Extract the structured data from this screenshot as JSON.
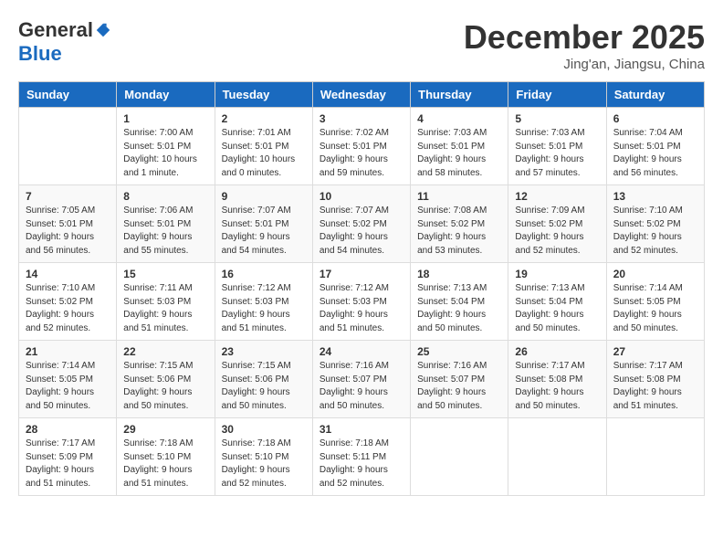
{
  "logo": {
    "general": "General",
    "blue": "Blue"
  },
  "header": {
    "month": "December 2025",
    "location": "Jing'an, Jiangsu, China"
  },
  "weekdays": [
    "Sunday",
    "Monday",
    "Tuesday",
    "Wednesday",
    "Thursday",
    "Friday",
    "Saturday"
  ],
  "weeks": [
    [
      {
        "day": "",
        "info": ""
      },
      {
        "day": "1",
        "info": "Sunrise: 7:00 AM\nSunset: 5:01 PM\nDaylight: 10 hours\nand 1 minute."
      },
      {
        "day": "2",
        "info": "Sunrise: 7:01 AM\nSunset: 5:01 PM\nDaylight: 10 hours\nand 0 minutes."
      },
      {
        "day": "3",
        "info": "Sunrise: 7:02 AM\nSunset: 5:01 PM\nDaylight: 9 hours\nand 59 minutes."
      },
      {
        "day": "4",
        "info": "Sunrise: 7:03 AM\nSunset: 5:01 PM\nDaylight: 9 hours\nand 58 minutes."
      },
      {
        "day": "5",
        "info": "Sunrise: 7:03 AM\nSunset: 5:01 PM\nDaylight: 9 hours\nand 57 minutes."
      },
      {
        "day": "6",
        "info": "Sunrise: 7:04 AM\nSunset: 5:01 PM\nDaylight: 9 hours\nand 56 minutes."
      }
    ],
    [
      {
        "day": "7",
        "info": "Sunrise: 7:05 AM\nSunset: 5:01 PM\nDaylight: 9 hours\nand 56 minutes."
      },
      {
        "day": "8",
        "info": "Sunrise: 7:06 AM\nSunset: 5:01 PM\nDaylight: 9 hours\nand 55 minutes."
      },
      {
        "day": "9",
        "info": "Sunrise: 7:07 AM\nSunset: 5:01 PM\nDaylight: 9 hours\nand 54 minutes."
      },
      {
        "day": "10",
        "info": "Sunrise: 7:07 AM\nSunset: 5:02 PM\nDaylight: 9 hours\nand 54 minutes."
      },
      {
        "day": "11",
        "info": "Sunrise: 7:08 AM\nSunset: 5:02 PM\nDaylight: 9 hours\nand 53 minutes."
      },
      {
        "day": "12",
        "info": "Sunrise: 7:09 AM\nSunset: 5:02 PM\nDaylight: 9 hours\nand 52 minutes."
      },
      {
        "day": "13",
        "info": "Sunrise: 7:10 AM\nSunset: 5:02 PM\nDaylight: 9 hours\nand 52 minutes."
      }
    ],
    [
      {
        "day": "14",
        "info": "Sunrise: 7:10 AM\nSunset: 5:02 PM\nDaylight: 9 hours\nand 52 minutes."
      },
      {
        "day": "15",
        "info": "Sunrise: 7:11 AM\nSunset: 5:03 PM\nDaylight: 9 hours\nand 51 minutes."
      },
      {
        "day": "16",
        "info": "Sunrise: 7:12 AM\nSunset: 5:03 PM\nDaylight: 9 hours\nand 51 minutes."
      },
      {
        "day": "17",
        "info": "Sunrise: 7:12 AM\nSunset: 5:03 PM\nDaylight: 9 hours\nand 51 minutes."
      },
      {
        "day": "18",
        "info": "Sunrise: 7:13 AM\nSunset: 5:04 PM\nDaylight: 9 hours\nand 50 minutes."
      },
      {
        "day": "19",
        "info": "Sunrise: 7:13 AM\nSunset: 5:04 PM\nDaylight: 9 hours\nand 50 minutes."
      },
      {
        "day": "20",
        "info": "Sunrise: 7:14 AM\nSunset: 5:05 PM\nDaylight: 9 hours\nand 50 minutes."
      }
    ],
    [
      {
        "day": "21",
        "info": "Sunrise: 7:14 AM\nSunset: 5:05 PM\nDaylight: 9 hours\nand 50 minutes."
      },
      {
        "day": "22",
        "info": "Sunrise: 7:15 AM\nSunset: 5:06 PM\nDaylight: 9 hours\nand 50 minutes."
      },
      {
        "day": "23",
        "info": "Sunrise: 7:15 AM\nSunset: 5:06 PM\nDaylight: 9 hours\nand 50 minutes."
      },
      {
        "day": "24",
        "info": "Sunrise: 7:16 AM\nSunset: 5:07 PM\nDaylight: 9 hours\nand 50 minutes."
      },
      {
        "day": "25",
        "info": "Sunrise: 7:16 AM\nSunset: 5:07 PM\nDaylight: 9 hours\nand 50 minutes."
      },
      {
        "day": "26",
        "info": "Sunrise: 7:17 AM\nSunset: 5:08 PM\nDaylight: 9 hours\nand 50 minutes."
      },
      {
        "day": "27",
        "info": "Sunrise: 7:17 AM\nSunset: 5:08 PM\nDaylight: 9 hours\nand 51 minutes."
      }
    ],
    [
      {
        "day": "28",
        "info": "Sunrise: 7:17 AM\nSunset: 5:09 PM\nDaylight: 9 hours\nand 51 minutes."
      },
      {
        "day": "29",
        "info": "Sunrise: 7:18 AM\nSunset: 5:10 PM\nDaylight: 9 hours\nand 51 minutes."
      },
      {
        "day": "30",
        "info": "Sunrise: 7:18 AM\nSunset: 5:10 PM\nDaylight: 9 hours\nand 52 minutes."
      },
      {
        "day": "31",
        "info": "Sunrise: 7:18 AM\nSunset: 5:11 PM\nDaylight: 9 hours\nand 52 minutes."
      },
      {
        "day": "",
        "info": ""
      },
      {
        "day": "",
        "info": ""
      },
      {
        "day": "",
        "info": ""
      }
    ]
  ]
}
